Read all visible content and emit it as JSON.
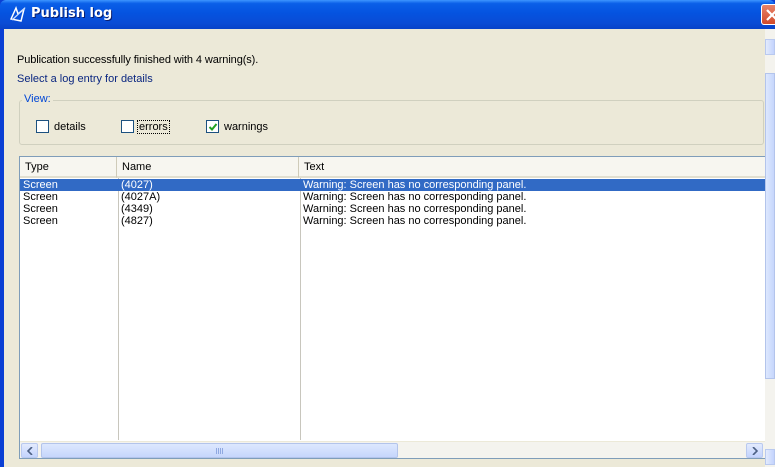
{
  "window": {
    "title": "Publish log",
    "icon": "publish-log-icon",
    "close_icon": "close-icon"
  },
  "messages": {
    "status": "Publication successfully finished with 4 warning(s).",
    "hint": "Select a log entry for details"
  },
  "view": {
    "legend": "View:",
    "options": [
      {
        "label": "details",
        "checked": false
      },
      {
        "label": "errors",
        "checked": false
      },
      {
        "label": "warnings",
        "checked": true
      }
    ]
  },
  "log": {
    "columns": [
      "Type",
      "Name",
      "Text"
    ],
    "rows": [
      {
        "type": "Screen",
        "name": "(4027)",
        "text": "Warning: Screen has no corresponding panel.",
        "selected": true
      },
      {
        "type": "Screen",
        "name": "(4027A)",
        "text": "Warning: Screen has no corresponding panel.",
        "selected": false
      },
      {
        "type": "Screen",
        "name": "(4349)",
        "text": "Warning: Screen has no corresponding panel.",
        "selected": false
      },
      {
        "type": "Screen",
        "name": "(4827)",
        "text": "Warning: Screen has no corresponding panel.",
        "selected": false
      }
    ]
  },
  "scrollbar": {
    "left_icon": "scroll-left-icon",
    "right_icon": "scroll-right-icon"
  },
  "colors": {
    "titlebar": "#0553e0",
    "selection": "#316ac5",
    "dialog_bg": "#ece9d8"
  }
}
